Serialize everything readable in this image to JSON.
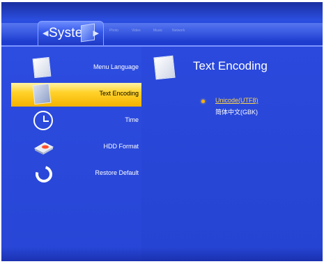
{
  "header": {
    "active_tab": "System",
    "other_tabs": [
      "Photo",
      "Video",
      "Music",
      "Network"
    ]
  },
  "menu": {
    "items": [
      {
        "label": "Menu Language",
        "icon": "document-icon"
      },
      {
        "label": "Text Encoding",
        "icon": "document-icon",
        "selected": true
      },
      {
        "label": "Time",
        "icon": "clock-icon"
      },
      {
        "label": "HDD Format",
        "icon": "hard-drive-icon"
      },
      {
        "label": "Restore Default",
        "icon": "restore-icon"
      }
    ]
  },
  "detail": {
    "title": "Text Encoding",
    "options": [
      {
        "label": "Unicode(UTF8)",
        "selected": true
      },
      {
        "label": "简体中文(GBK)",
        "selected": false
      }
    ]
  },
  "colors": {
    "background": "#1f37c9",
    "highlight": "#ffd22a",
    "selected_option": "#ffd64a"
  }
}
